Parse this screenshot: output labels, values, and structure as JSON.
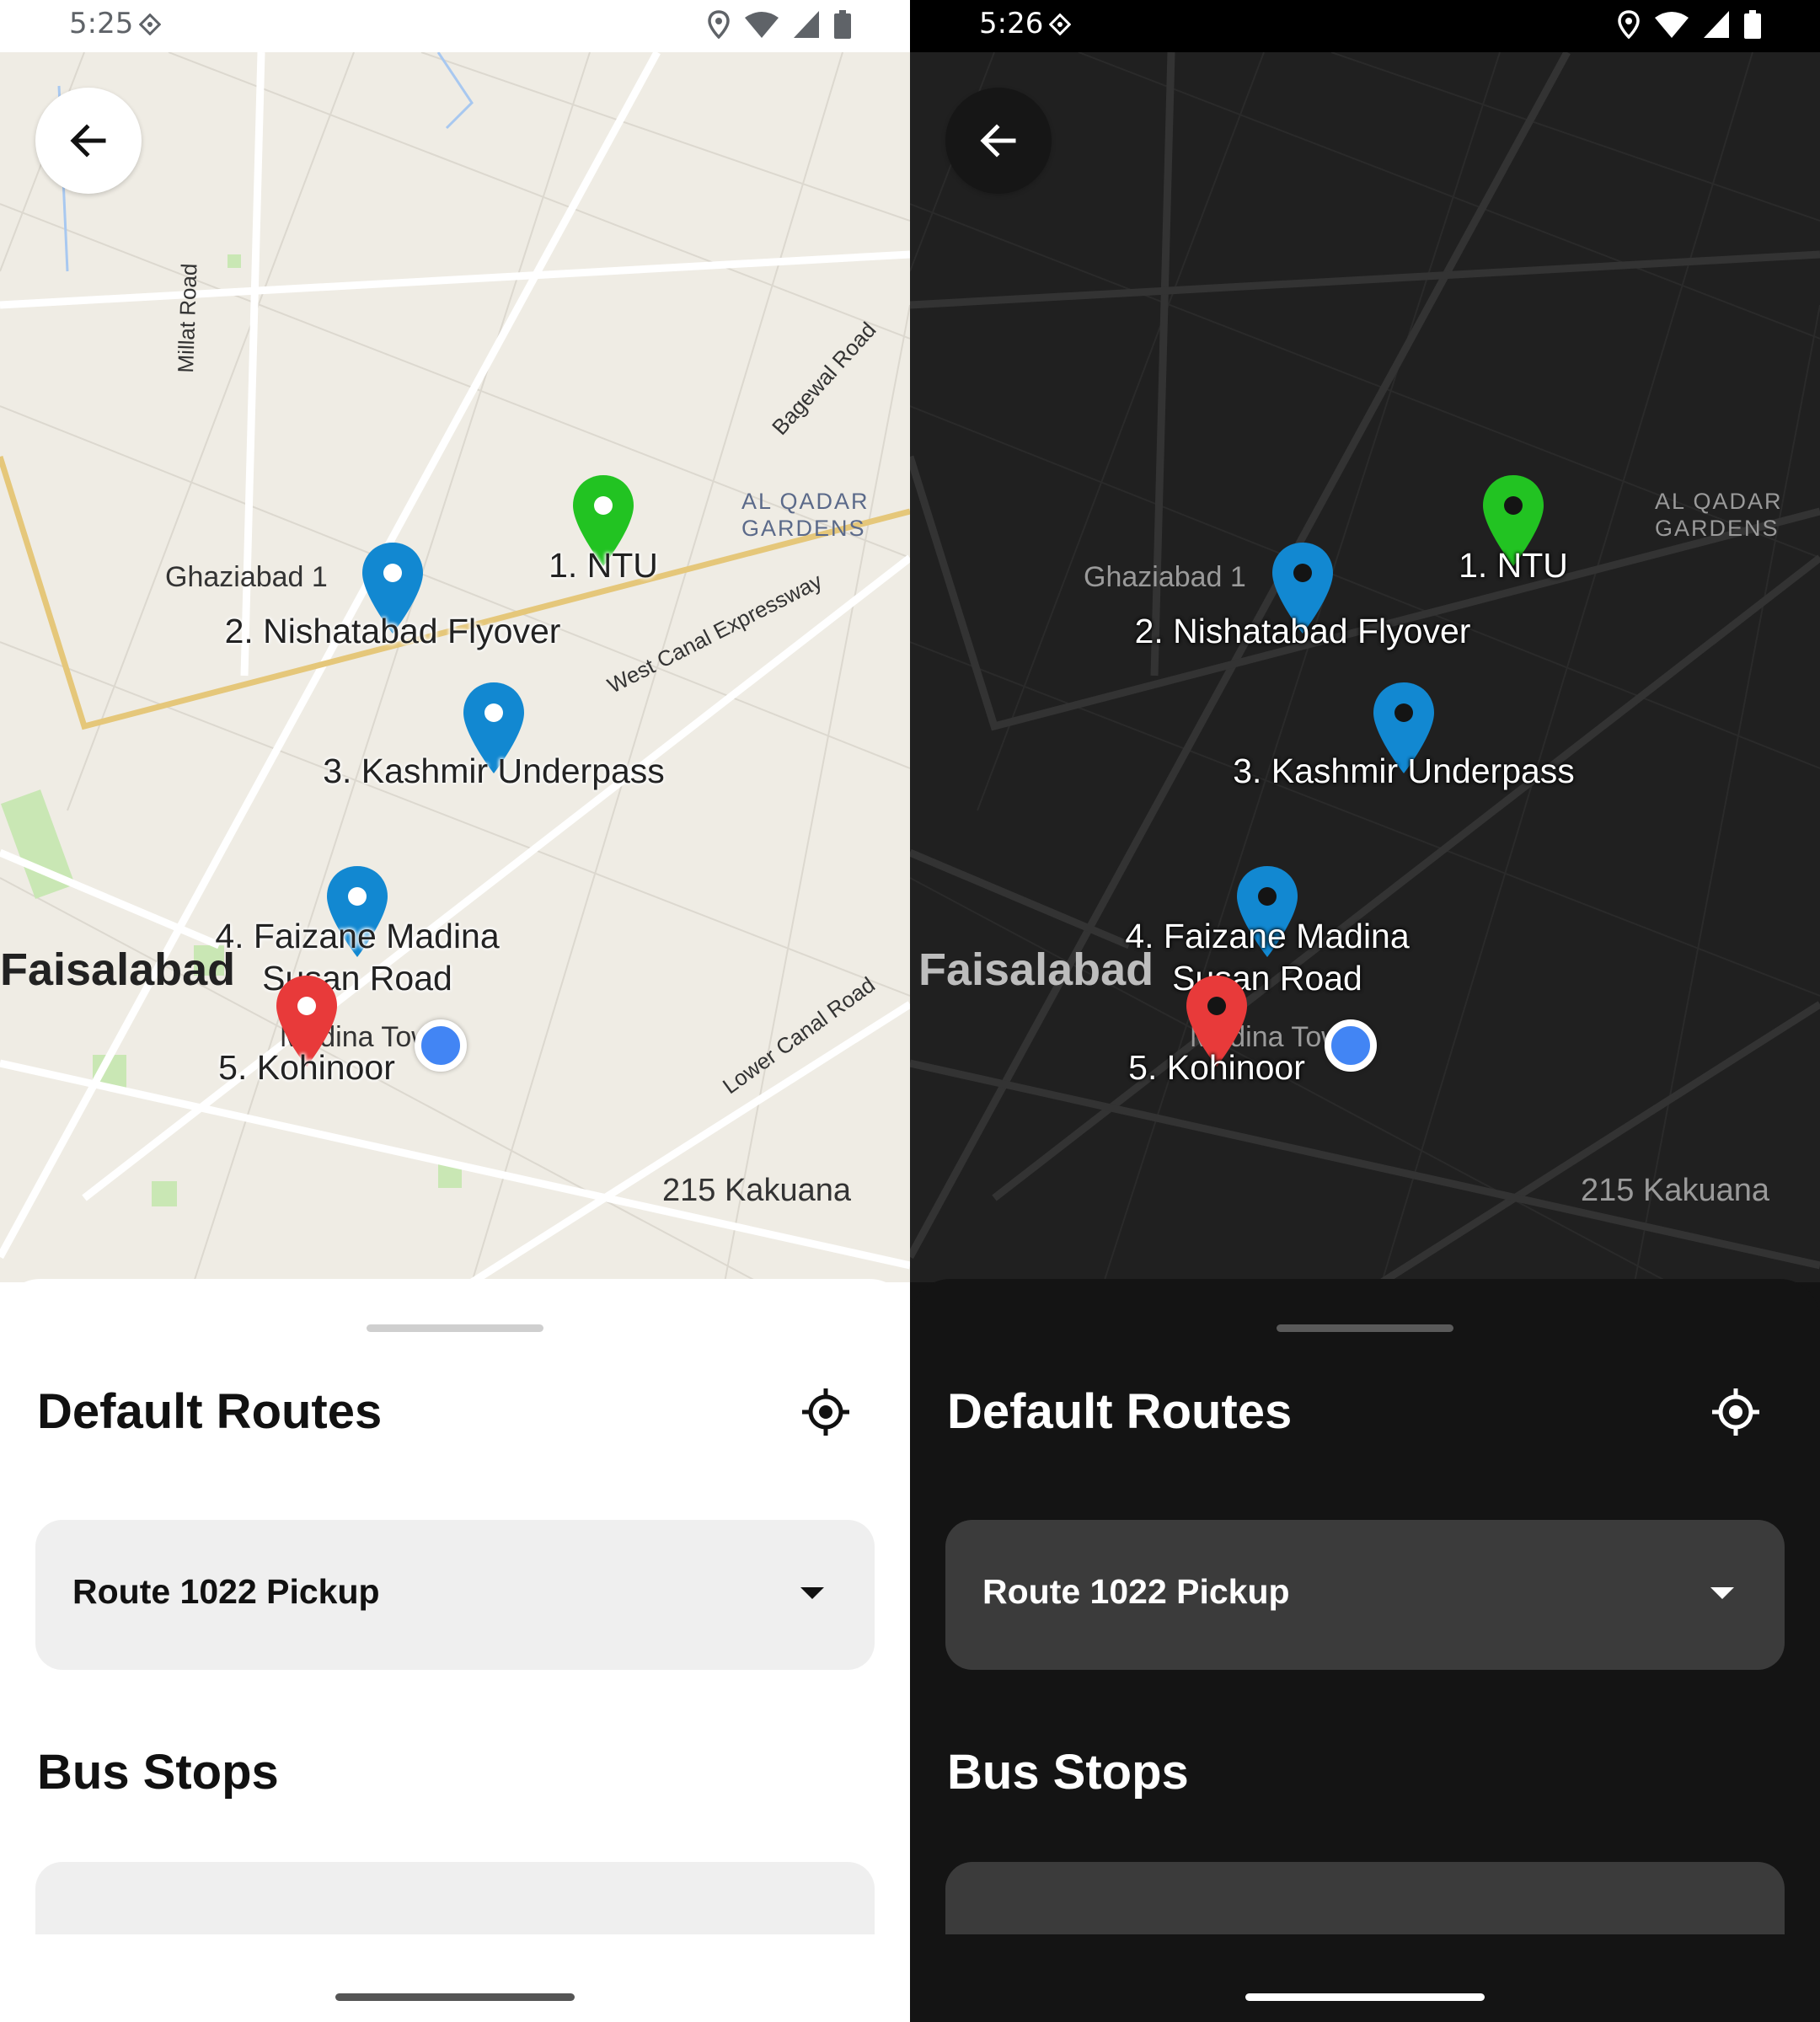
{
  "screens": {
    "light": {
      "status_time": "5:25",
      "theme": "light",
      "map_colors": {
        "land": "#efece4",
        "road": "#ffffff",
        "highway": "#e5c77a",
        "park": "#c9e7b4",
        "water": "#a8c8f0",
        "grid": "#dcd8cf"
      }
    },
    "dark": {
      "status_time": "5:26",
      "theme": "dark",
      "map_colors": {
        "land": "#202020",
        "road": "#3a3a3a",
        "highway": "#3a3a3a",
        "park": "#242424",
        "water": "#1c1c1c",
        "grid": "#2a2a2a"
      }
    }
  },
  "map_labels": {
    "ghaziabad": "Ghaziabad 1",
    "al_qadar_1": "AL QADAR",
    "al_qadar_2": "GARDENS",
    "faisalabad": "Faisalabad",
    "madina_town": "Madina Town",
    "kakuana": "215 Kakuana",
    "millat_road": "Millat Road",
    "bagewal_road": "Bagewal Road",
    "west_canal": "West Canal Expressway",
    "lower_canal": "Lower Canal Road"
  },
  "stops": [
    {
      "label": "1. NTU",
      "color": "#22c322"
    },
    {
      "label": "2. Nishatabad Flyover",
      "color": "#1288d1"
    },
    {
      "label": "3. Kashmir Underpass",
      "color": "#1288d1"
    },
    {
      "label": "4. Faizane Madina Susan Road",
      "label_line1": "4. Faizane Madina",
      "label_line2": "Susan Road",
      "color": "#1288d1"
    },
    {
      "label": "5. Kohinoor",
      "color": "#e83a3a"
    }
  ],
  "sheet": {
    "title": "Default Routes",
    "selected_route": "Route 1022 Pickup",
    "section_title": "Bus Stops"
  },
  "icons": {
    "back": "arrow-left-icon",
    "locate": "my-location-icon",
    "dropdown": "chevron-down-icon"
  }
}
